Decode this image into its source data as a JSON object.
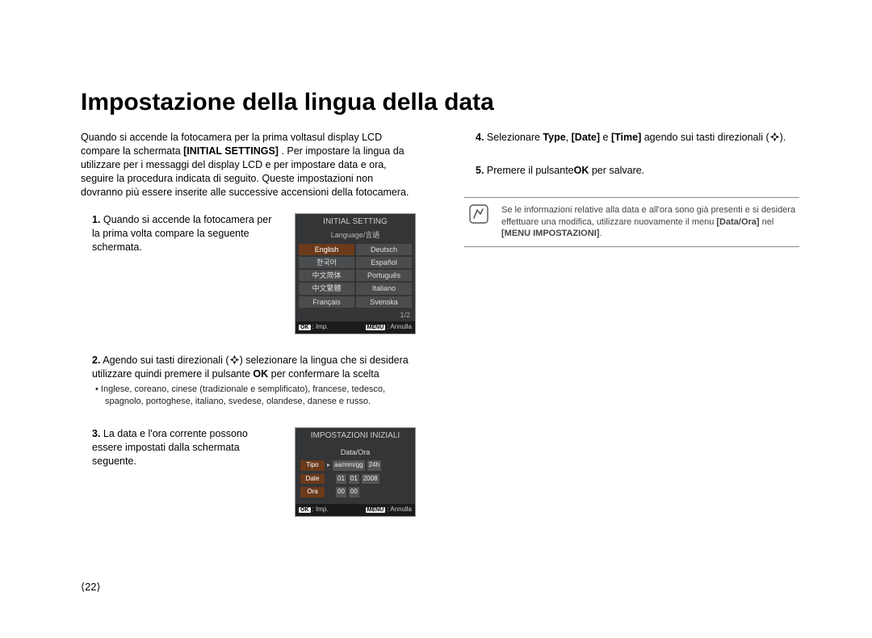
{
  "title": "Impostazione della lingua della data",
  "intro_pre": "Quando si accende la fotocamera per la prima voltasul display LCD compare la schermata ",
  "intro_bold": "[INITIAL SETTINGS]",
  "intro_post": " . Per impostare la lingua da utilizzare per i messaggi del display LCD e per impostare data e ora, seguire la procedura indicata di seguito. Queste impostazioni non dovranno più essere inserite alle successive accensioni della fotocamera.",
  "step1": {
    "num": "1.",
    "text": "Quando si accende la fotocamera per la prima volta compare la seguente schermata."
  },
  "lcd1": {
    "title": "INITIAL SETTING",
    "sub": "Language/言語",
    "langs": [
      "English",
      "Deutsch",
      "한국어",
      "Español",
      "中文简体",
      "Português",
      "中文繁體",
      "Italiano",
      "Français",
      "Svenska"
    ],
    "page": "1/2",
    "ok": "OK",
    "okLabel": ": Imp.",
    "menu": "MENU",
    "menuLabel": ": Annulla"
  },
  "step2": {
    "num": "2.",
    "pre": "Agendo sui tasti direzionali (",
    "mid": ") selezionare la lingua che si desidera utilizzare quindi premere il pulsante ",
    "okbold": "OK",
    "post": " per confermare la scelta",
    "bullet": "Inglese, coreano, cinese (tradizionale e semplificato), francese, tedesco, spagnolo, portoghese, italiano, svedese, olandese, danese e russo."
  },
  "step3": {
    "num": "3.",
    "text": "La data e l'ora corrente possono essere impostati dalla schermata seguente."
  },
  "lcd2": {
    "title": "IMPOSTAZIONI INIZIALI",
    "sub": "Data/Ora",
    "rows": {
      "tipo": {
        "label": "Tipo",
        "v1": "aa/mm/gg",
        "v2": "24h"
      },
      "date": {
        "label": "Date",
        "v1": "01",
        "v2": "01",
        "v3": "2008"
      },
      "ora": {
        "label": "Ora",
        "v1": "00",
        "v2": "00"
      }
    },
    "ok": "OK",
    "okLabel": ": Imp.",
    "menu": "MENU",
    "menuLabel": ": Annulla"
  },
  "step4": {
    "num": "4.",
    "pre": "Selezionare ",
    "b1": "Type",
    "c1": ", ",
    "b2": "[Date]",
    "c2": " e ",
    "b3": "[Time]",
    "post": " agendo sui tasti direzionali (",
    "end": ")."
  },
  "step5": {
    "num": "5.",
    "pre": "Premere il pulsante",
    "b": "OK",
    "post": " per salvare."
  },
  "note": {
    "pre": "Se le informazioni relative alla data e all'ora sono già presenti e si desidera effettuare una modifica, utilizzare nuovamente il menu ",
    "b1": "[Data/Ora]",
    "mid": " nel ",
    "b2": "[MENU IMPOSTAZIONI]",
    "post": "."
  },
  "pageNumber": "⟨22⟩"
}
